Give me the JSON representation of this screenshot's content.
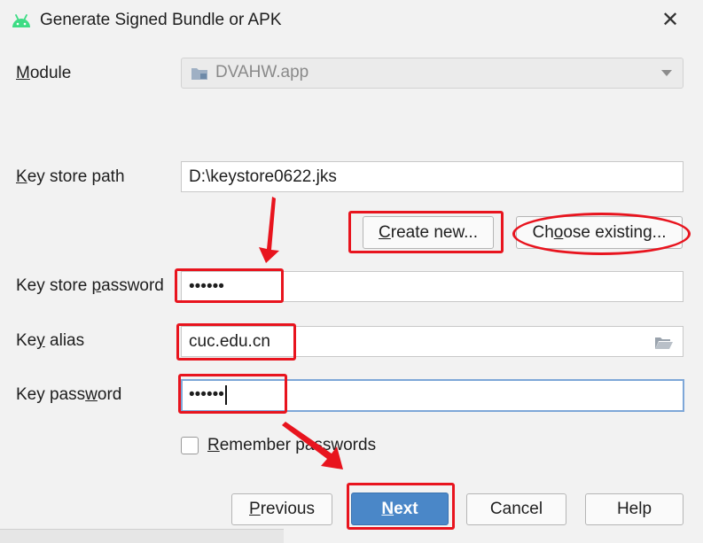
{
  "dialog": {
    "title": "Generate Signed Bundle or APK",
    "close_glyph": "✕",
    "app_icon": "android-icon"
  },
  "module": {
    "label_first": "M",
    "label_rest": "odule",
    "value": "DVAHW.app",
    "folder_icon": "module-folder-icon",
    "dropdown_icon": "chevron-down-icon"
  },
  "keystore_path": {
    "label_first": "K",
    "label_rest": "ey store path",
    "value": "D:\\keystore0622.jks"
  },
  "buttons": {
    "create_new_first": "C",
    "create_new_rest": "reate new...",
    "choose_existing_pre": "Ch",
    "choose_existing_u": "o",
    "choose_existing_rest": "ose existing...",
    "previous_first": "P",
    "previous_rest": "revious",
    "next_first": "N",
    "next_rest": "ext",
    "cancel": "Cancel",
    "help": "Help"
  },
  "keystore_password": {
    "label_pre": "Key store ",
    "label_u": "p",
    "label_rest": "assword",
    "value": "••••••"
  },
  "key_alias": {
    "label_pre": "Ke",
    "label_u": "y",
    "label_rest": " alias",
    "value": "cuc.edu.cn",
    "browse_icon": "folder-open-icon"
  },
  "key_password": {
    "label_pre": "Key pass",
    "label_u": "w",
    "label_rest": "ord",
    "value": "••••••"
  },
  "remember": {
    "label_first": "R",
    "label_rest": "emember passwords",
    "checked": false
  },
  "annotations": {
    "color": "#e8141e"
  }
}
